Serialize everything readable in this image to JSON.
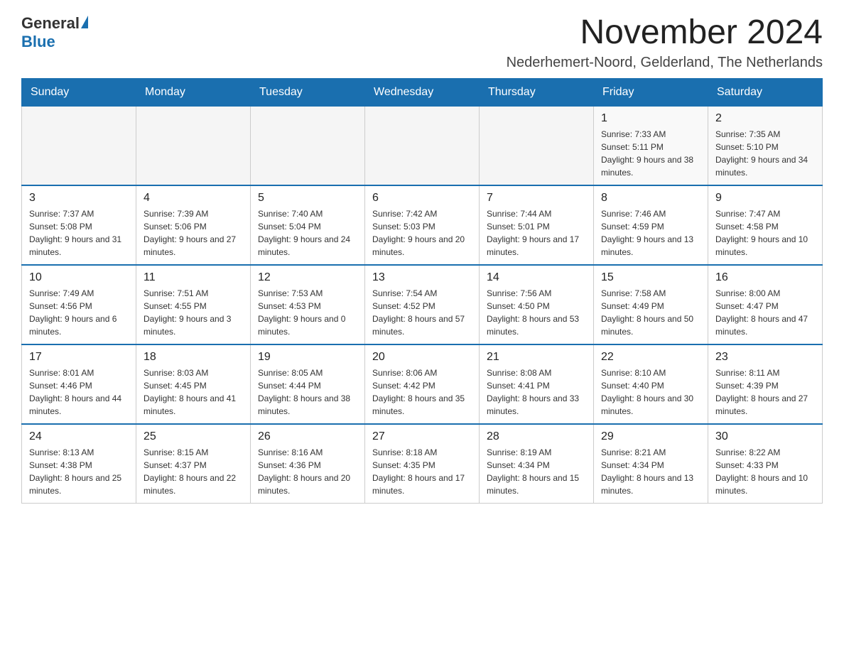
{
  "header": {
    "logo": {
      "general": "General",
      "blue": "Blue"
    },
    "title": "November 2024",
    "subtitle": "Nederhemert-Noord, Gelderland, The Netherlands"
  },
  "weekdays": [
    "Sunday",
    "Monday",
    "Tuesday",
    "Wednesday",
    "Thursday",
    "Friday",
    "Saturday"
  ],
  "weeks": [
    [
      {
        "day": "",
        "info": ""
      },
      {
        "day": "",
        "info": ""
      },
      {
        "day": "",
        "info": ""
      },
      {
        "day": "",
        "info": ""
      },
      {
        "day": "",
        "info": ""
      },
      {
        "day": "1",
        "info": "Sunrise: 7:33 AM\nSunset: 5:11 PM\nDaylight: 9 hours and 38 minutes."
      },
      {
        "day": "2",
        "info": "Sunrise: 7:35 AM\nSunset: 5:10 PM\nDaylight: 9 hours and 34 minutes."
      }
    ],
    [
      {
        "day": "3",
        "info": "Sunrise: 7:37 AM\nSunset: 5:08 PM\nDaylight: 9 hours and 31 minutes."
      },
      {
        "day": "4",
        "info": "Sunrise: 7:39 AM\nSunset: 5:06 PM\nDaylight: 9 hours and 27 minutes."
      },
      {
        "day": "5",
        "info": "Sunrise: 7:40 AM\nSunset: 5:04 PM\nDaylight: 9 hours and 24 minutes."
      },
      {
        "day": "6",
        "info": "Sunrise: 7:42 AM\nSunset: 5:03 PM\nDaylight: 9 hours and 20 minutes."
      },
      {
        "day": "7",
        "info": "Sunrise: 7:44 AM\nSunset: 5:01 PM\nDaylight: 9 hours and 17 minutes."
      },
      {
        "day": "8",
        "info": "Sunrise: 7:46 AM\nSunset: 4:59 PM\nDaylight: 9 hours and 13 minutes."
      },
      {
        "day": "9",
        "info": "Sunrise: 7:47 AM\nSunset: 4:58 PM\nDaylight: 9 hours and 10 minutes."
      }
    ],
    [
      {
        "day": "10",
        "info": "Sunrise: 7:49 AM\nSunset: 4:56 PM\nDaylight: 9 hours and 6 minutes."
      },
      {
        "day": "11",
        "info": "Sunrise: 7:51 AM\nSunset: 4:55 PM\nDaylight: 9 hours and 3 minutes."
      },
      {
        "day": "12",
        "info": "Sunrise: 7:53 AM\nSunset: 4:53 PM\nDaylight: 9 hours and 0 minutes."
      },
      {
        "day": "13",
        "info": "Sunrise: 7:54 AM\nSunset: 4:52 PM\nDaylight: 8 hours and 57 minutes."
      },
      {
        "day": "14",
        "info": "Sunrise: 7:56 AM\nSunset: 4:50 PM\nDaylight: 8 hours and 53 minutes."
      },
      {
        "day": "15",
        "info": "Sunrise: 7:58 AM\nSunset: 4:49 PM\nDaylight: 8 hours and 50 minutes."
      },
      {
        "day": "16",
        "info": "Sunrise: 8:00 AM\nSunset: 4:47 PM\nDaylight: 8 hours and 47 minutes."
      }
    ],
    [
      {
        "day": "17",
        "info": "Sunrise: 8:01 AM\nSunset: 4:46 PM\nDaylight: 8 hours and 44 minutes."
      },
      {
        "day": "18",
        "info": "Sunrise: 8:03 AM\nSunset: 4:45 PM\nDaylight: 8 hours and 41 minutes."
      },
      {
        "day": "19",
        "info": "Sunrise: 8:05 AM\nSunset: 4:44 PM\nDaylight: 8 hours and 38 minutes."
      },
      {
        "day": "20",
        "info": "Sunrise: 8:06 AM\nSunset: 4:42 PM\nDaylight: 8 hours and 35 minutes."
      },
      {
        "day": "21",
        "info": "Sunrise: 8:08 AM\nSunset: 4:41 PM\nDaylight: 8 hours and 33 minutes."
      },
      {
        "day": "22",
        "info": "Sunrise: 8:10 AM\nSunset: 4:40 PM\nDaylight: 8 hours and 30 minutes."
      },
      {
        "day": "23",
        "info": "Sunrise: 8:11 AM\nSunset: 4:39 PM\nDaylight: 8 hours and 27 minutes."
      }
    ],
    [
      {
        "day": "24",
        "info": "Sunrise: 8:13 AM\nSunset: 4:38 PM\nDaylight: 8 hours and 25 minutes."
      },
      {
        "day": "25",
        "info": "Sunrise: 8:15 AM\nSunset: 4:37 PM\nDaylight: 8 hours and 22 minutes."
      },
      {
        "day": "26",
        "info": "Sunrise: 8:16 AM\nSunset: 4:36 PM\nDaylight: 8 hours and 20 minutes."
      },
      {
        "day": "27",
        "info": "Sunrise: 8:18 AM\nSunset: 4:35 PM\nDaylight: 8 hours and 17 minutes."
      },
      {
        "day": "28",
        "info": "Sunrise: 8:19 AM\nSunset: 4:34 PM\nDaylight: 8 hours and 15 minutes."
      },
      {
        "day": "29",
        "info": "Sunrise: 8:21 AM\nSunset: 4:34 PM\nDaylight: 8 hours and 13 minutes."
      },
      {
        "day": "30",
        "info": "Sunrise: 8:22 AM\nSunset: 4:33 PM\nDaylight: 8 hours and 10 minutes."
      }
    ]
  ]
}
